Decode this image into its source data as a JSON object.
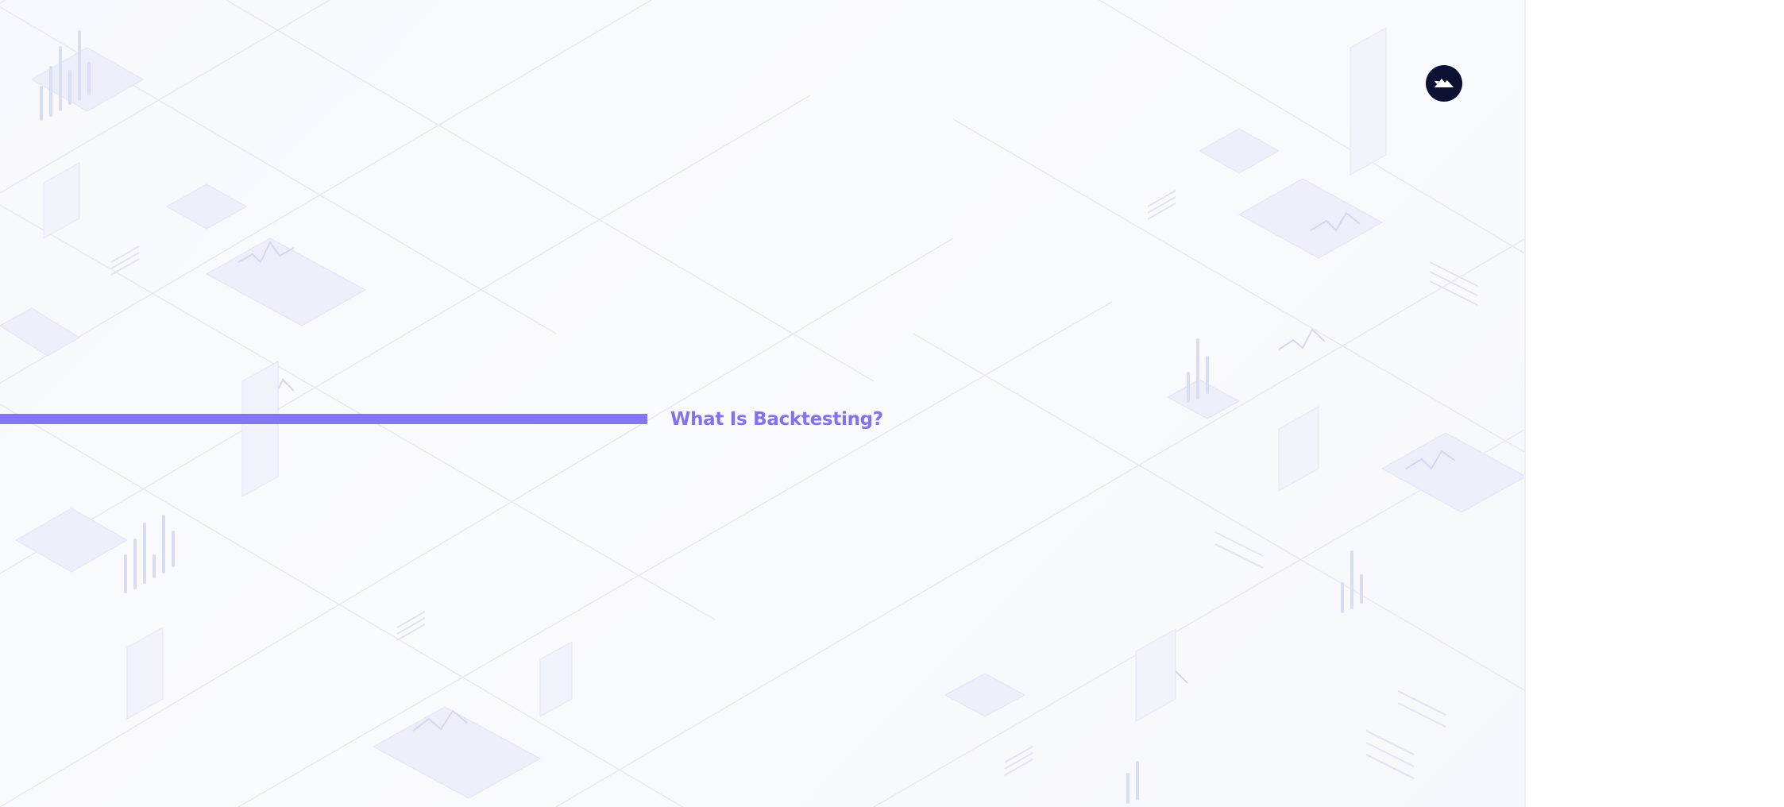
{
  "slide": {
    "title": "What Is Backtesting?",
    "accent_color": "#8475f4",
    "title_color": "#8272ee",
    "background_color": "#f8f9fd"
  },
  "logo": {
    "icon": "mountain-logo-icon",
    "background_color": "#0c1133"
  }
}
